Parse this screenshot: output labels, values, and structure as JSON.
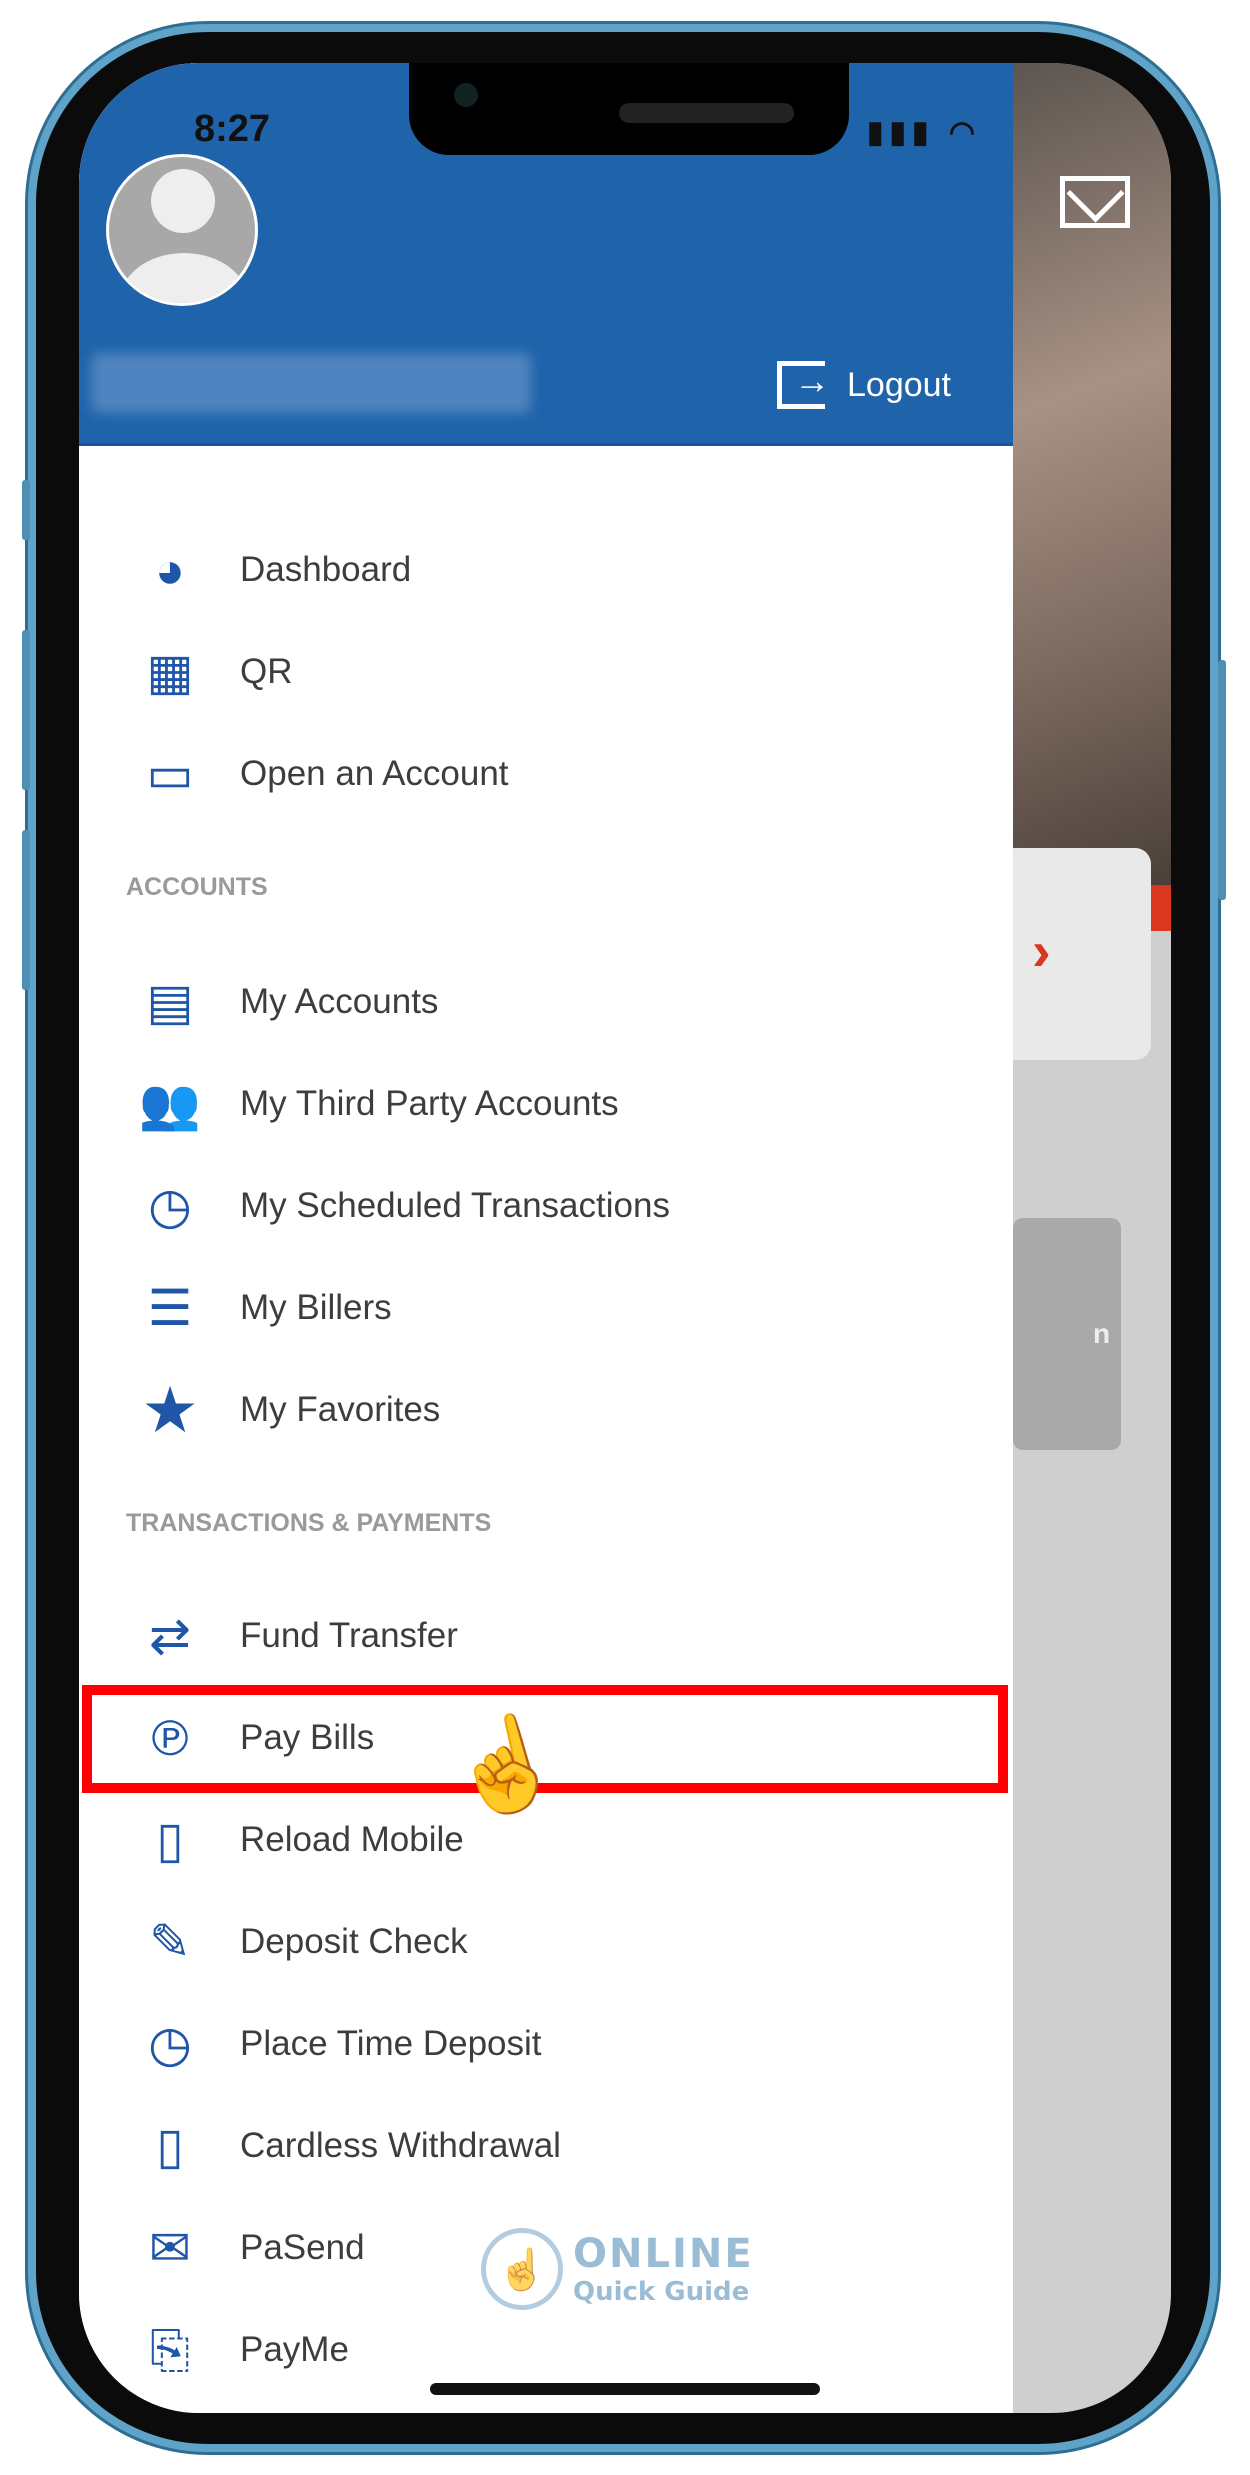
{
  "status_bar": {
    "time": "8:27",
    "signal_icon": "signal-icon",
    "wifi_icon": "wifi-icon"
  },
  "header": {
    "avatar_icon": "user-avatar-icon",
    "logout_label": "Logout",
    "logout_icon": "logout-icon"
  },
  "background": {
    "mail_icon": "mail-icon",
    "chevron_icon": "chevron-right-icon",
    "partial_text": "n",
    "accent": "#d9381e"
  },
  "menu": {
    "top_items": [
      {
        "label": "Dashboard",
        "icon": "dashboard-icon"
      },
      {
        "label": "QR",
        "icon": "qr-icon"
      },
      {
        "label": "Open an Account",
        "icon": "open-account-icon"
      }
    ],
    "accounts_title": "ACCOUNTS",
    "accounts_items": [
      {
        "label": "My Accounts",
        "icon": "id-card-icon"
      },
      {
        "label": "My Third Party Accounts",
        "icon": "users-icon"
      },
      {
        "label": "My Scheduled Transactions",
        "icon": "clock-calendar-icon"
      },
      {
        "label": "My Billers",
        "icon": "receipt-icon"
      },
      {
        "label": "My Favorites",
        "icon": "star-icon"
      }
    ],
    "transactions_title": "TRANSACTIONS & PAYMENTS",
    "transactions_items": [
      {
        "label": "Fund Transfer",
        "icon": "fund-transfer-icon"
      },
      {
        "label": "Pay Bills",
        "icon": "pay-bills-icon",
        "highlighted": true
      },
      {
        "label": "Reload Mobile",
        "icon": "mobile-icon"
      },
      {
        "label": "Deposit Check",
        "icon": "check-icon"
      },
      {
        "label": "Place Time Deposit",
        "icon": "time-deposit-icon"
      },
      {
        "label": "Cardless Withdrawal",
        "icon": "cardless-icon"
      },
      {
        "label": "PaSend",
        "icon": "pasend-icon"
      },
      {
        "label": "PayMe",
        "icon": "payme-icon"
      }
    ]
  },
  "watermark": {
    "line1": "ONLINE",
    "line2": "Quick Guide"
  },
  "colors": {
    "header": "#1f63aa",
    "highlight": "#ff0000",
    "icon": "#1f56a8"
  }
}
